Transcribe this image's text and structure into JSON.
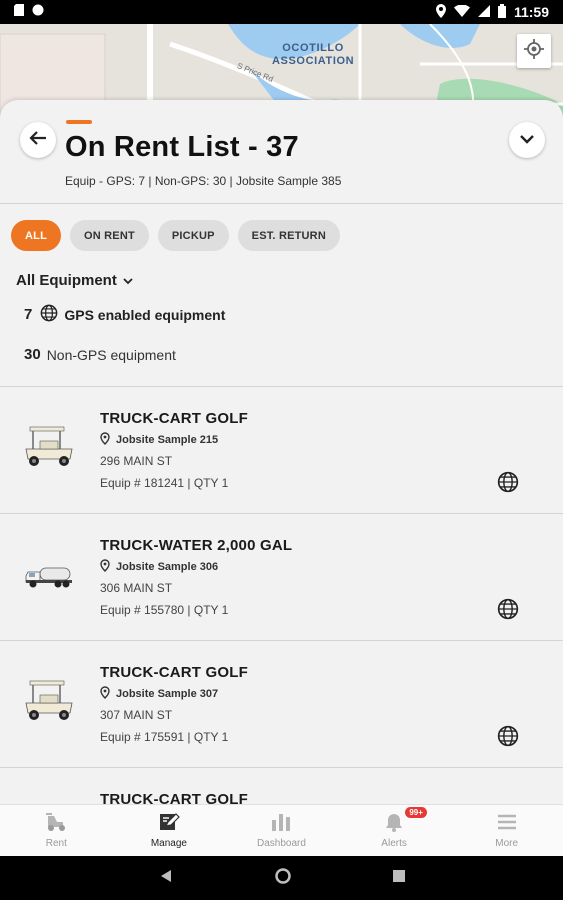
{
  "status_bar": {
    "time": "11:59"
  },
  "map": {
    "area_label_line1": "OCOTILLO",
    "area_label_line2": "ASSOCIATION",
    "road_label": "S Price Rd"
  },
  "header": {
    "title": "On Rent List - 37",
    "subtitle": "Equip - GPS:  7 | Non-GPS: 30 | Jobsite Sample 385"
  },
  "chips": [
    {
      "label": "ALL",
      "active": true
    },
    {
      "label": "ON RENT",
      "active": false
    },
    {
      "label": "PICKUP",
      "active": false
    },
    {
      "label": "EST. RETURN",
      "active": false
    }
  ],
  "filter": {
    "label": "All Equipment"
  },
  "summary": {
    "gps_count": "7",
    "gps_label": "GPS enabled equipment",
    "nongps_count": "30",
    "nongps_label": "Non-GPS equipment"
  },
  "items": [
    {
      "name": "TRUCK-CART GOLF",
      "jobsite": "Jobsite Sample 215",
      "address": "296 MAIN ST",
      "equip": "Equip # 181241 | QTY 1",
      "image": "golf-cart"
    },
    {
      "name": "TRUCK-WATER 2,000 GAL",
      "jobsite": "Jobsite Sample 306",
      "address": "306 MAIN ST",
      "equip": "Equip # 155780 | QTY 1",
      "image": "water-truck"
    },
    {
      "name": "TRUCK-CART GOLF",
      "jobsite": "Jobsite Sample 307",
      "address": "307 MAIN ST",
      "equip": "Equip # 175591 | QTY 1",
      "image": "golf-cart"
    },
    {
      "name": "TRUCK-CART GOLF",
      "jobsite": "",
      "address": "",
      "equip": "",
      "image": "golf-cart"
    }
  ],
  "bottom_nav": [
    {
      "label": "Rent",
      "icon": "rent-icon",
      "active": false
    },
    {
      "label": "Manage",
      "icon": "manage-icon",
      "active": true
    },
    {
      "label": "Dashboard",
      "icon": "dashboard-icon",
      "active": false
    },
    {
      "label": "Alerts",
      "icon": "bell-icon",
      "active": false,
      "badge": "99+"
    },
    {
      "label": "More",
      "icon": "menu-icon",
      "active": false
    }
  ],
  "colors": {
    "accent": "#ee7623",
    "badge": "#e53935"
  }
}
